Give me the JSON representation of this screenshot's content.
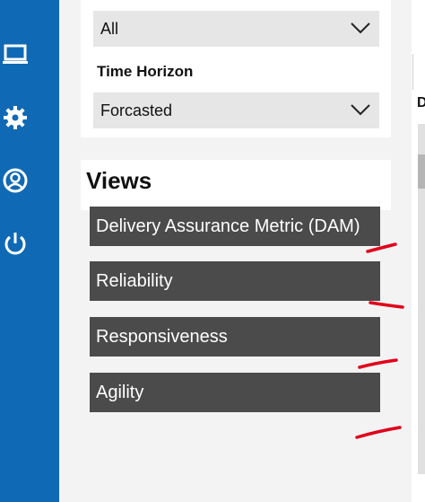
{
  "nav": {
    "items": [
      {
        "icon": "laptop-icon"
      },
      {
        "icon": "gear-icon"
      },
      {
        "icon": "user-circle-icon"
      },
      {
        "icon": "power-icon"
      }
    ]
  },
  "filters": {
    "first_select_value": "All",
    "time_horizon_label": "Time Horizon",
    "time_horizon_value": "Forcasted"
  },
  "views": {
    "heading": "Views",
    "items": [
      {
        "label": "Delivery Assurance Metric (DAM)"
      },
      {
        "label": "Reliability"
      },
      {
        "label": "Responsiveness"
      },
      {
        "label": "Agility"
      }
    ]
  },
  "right_panel": {
    "letter": "D"
  },
  "colors": {
    "nav_rail": "#0f69b4",
    "view_button": "#4b4b4b",
    "annotation_ink": "#e0001b"
  }
}
